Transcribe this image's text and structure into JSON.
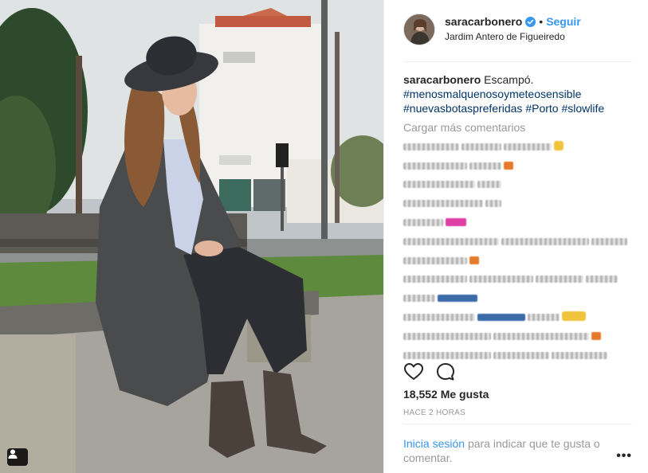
{
  "post": {
    "username": "saracarbonero",
    "follow_label": "Seguir",
    "separator": "•",
    "location": "Jardim Antero de Figueiredo",
    "caption": {
      "text": "Escampó.",
      "hashtags": [
        "#menosmalquenosoymeteosensible",
        "#nuevasbotaspreferidas",
        "#Porto",
        "#slowlife"
      ]
    },
    "load_more_label": "Cargar más comentarios",
    "likes": "18,552 Me gusta",
    "timestamp": "HACE 2 HORAS",
    "login_link": "Inicia sesión",
    "login_rest": "para indicar que te gusta o comentar.",
    "more_label": "•••"
  },
  "icons": {
    "verified": "verified-badge-icon",
    "like": "heart-icon",
    "comment": "comment-bubble-icon",
    "user_tag": "user-tag-icon",
    "options": "more-options-icon"
  },
  "colors": {
    "link_blue": "#3897f0",
    "hashtag": "#003569",
    "muted": "#999999",
    "text": "#262626"
  }
}
